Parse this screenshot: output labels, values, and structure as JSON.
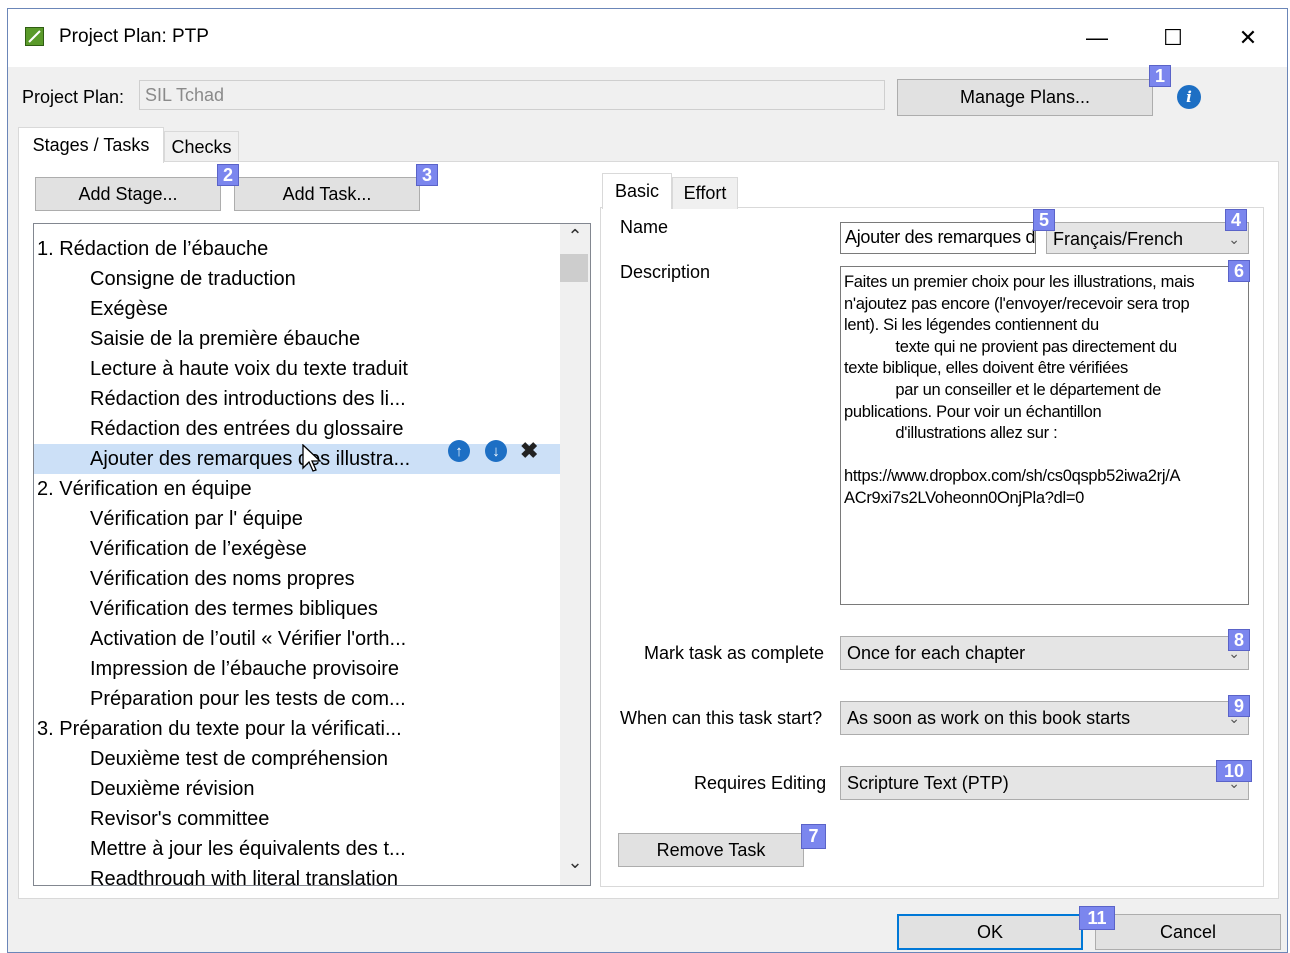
{
  "window": {
    "title": "Project Plan: PTP"
  },
  "window_controls": {
    "minimize": "—",
    "maximize": "☐",
    "close": "✕"
  },
  "project_plan": {
    "label": "Project Plan:",
    "value": "SIL Tchad",
    "manage_button": "Manage Plans...",
    "info_icon": "i"
  },
  "outer_tabs": {
    "stages_tasks": "Stages / Tasks",
    "checks": "Checks"
  },
  "buttons": {
    "add_stage": "Add Stage...",
    "add_task": "Add Task...",
    "remove_task": "Remove Task",
    "ok": "OK",
    "cancel": "Cancel"
  },
  "badges": [
    "1",
    "2",
    "3",
    "4",
    "5",
    "6",
    "7",
    "8",
    "9",
    "10",
    "11"
  ],
  "task_list": {
    "items": [
      {
        "text": "1. Rédaction de l’ébauche",
        "level": 0
      },
      {
        "text": "Consigne de traduction",
        "level": 1
      },
      {
        "text": "Exégèse",
        "level": 1
      },
      {
        "text": "Saisie de la première ébauche",
        "level": 1
      },
      {
        "text": "Lecture à haute voix du texte traduit",
        "level": 1
      },
      {
        "text": "Rédaction des introductions des li...",
        "level": 1
      },
      {
        "text": "Rédaction des entrées du glossaire",
        "level": 1
      },
      {
        "text": "Ajouter des remarques des illustra...",
        "level": 1,
        "selected": true
      },
      {
        "text": "2. Vérification en équipe",
        "level": 0
      },
      {
        "text": "Vérification par l' équipe",
        "level": 1
      },
      {
        "text": "Vérification de l’exégèse",
        "level": 1
      },
      {
        "text": "Vérification des noms propres",
        "level": 1
      },
      {
        "text": "Vérification des termes bibliques",
        "level": 1
      },
      {
        "text": "Activation de l’outil « Vérifier l'orth...",
        "level": 1
      },
      {
        "text": "Impression de l’ébauche provisoire",
        "level": 1
      },
      {
        "text": "Préparation pour les tests de com...",
        "level": 1
      },
      {
        "text": "3. Préparation du texte pour la vérificati...",
        "level": 0
      },
      {
        "text": "Deuxième test de compréhension",
        "level": 1
      },
      {
        "text": "Deuxième révision",
        "level": 1
      },
      {
        "text": "Revisor's committee",
        "level": 1
      },
      {
        "text": "Mettre à jour les équivalents des t...",
        "level": 1
      },
      {
        "text": "Readthrough with literal translation",
        "level": 1
      }
    ],
    "scroll_up": "⌃",
    "scroll_down": "⌄"
  },
  "detail_tabs": {
    "basic": "Basic",
    "effort": "Effort"
  },
  "form": {
    "name_label": "Name",
    "name_value": "Ajouter des remarques d",
    "language_value": "Français/French",
    "description_label": "Description",
    "description_lines": [
      "Faites un premier choix pour les illustrations, mais",
      "n'ajoutez pas encore (l'envoyer/recevoir sera trop",
      "lent). Si les légendes contiennent du",
      "            texte qui ne provient pas directement du",
      "texte biblique, elles doivent être vérifiées",
      "            par un conseiller et le département de",
      "publications. Pour voir un échantillon",
      "            d'illustrations allez sur :",
      "",
      "https://www.dropbox.com/sh/cs0qspb52iwa2rj/A",
      "ACr9xi7s2LVoheonn0OnjPla?dl=0"
    ],
    "mark_complete_label": "Mark task as complete",
    "mark_complete_value": "Once for each chapter",
    "start_label": "When can this task start?",
    "start_value": "As soon as work on this book starts",
    "editing_label": "Requires Editing",
    "editing_value": "Scripture Text (PTP)"
  },
  "colors": {
    "badge": "#7b86ee",
    "selection": "#cce0f7",
    "accent_icon": "#1d6fc4"
  }
}
